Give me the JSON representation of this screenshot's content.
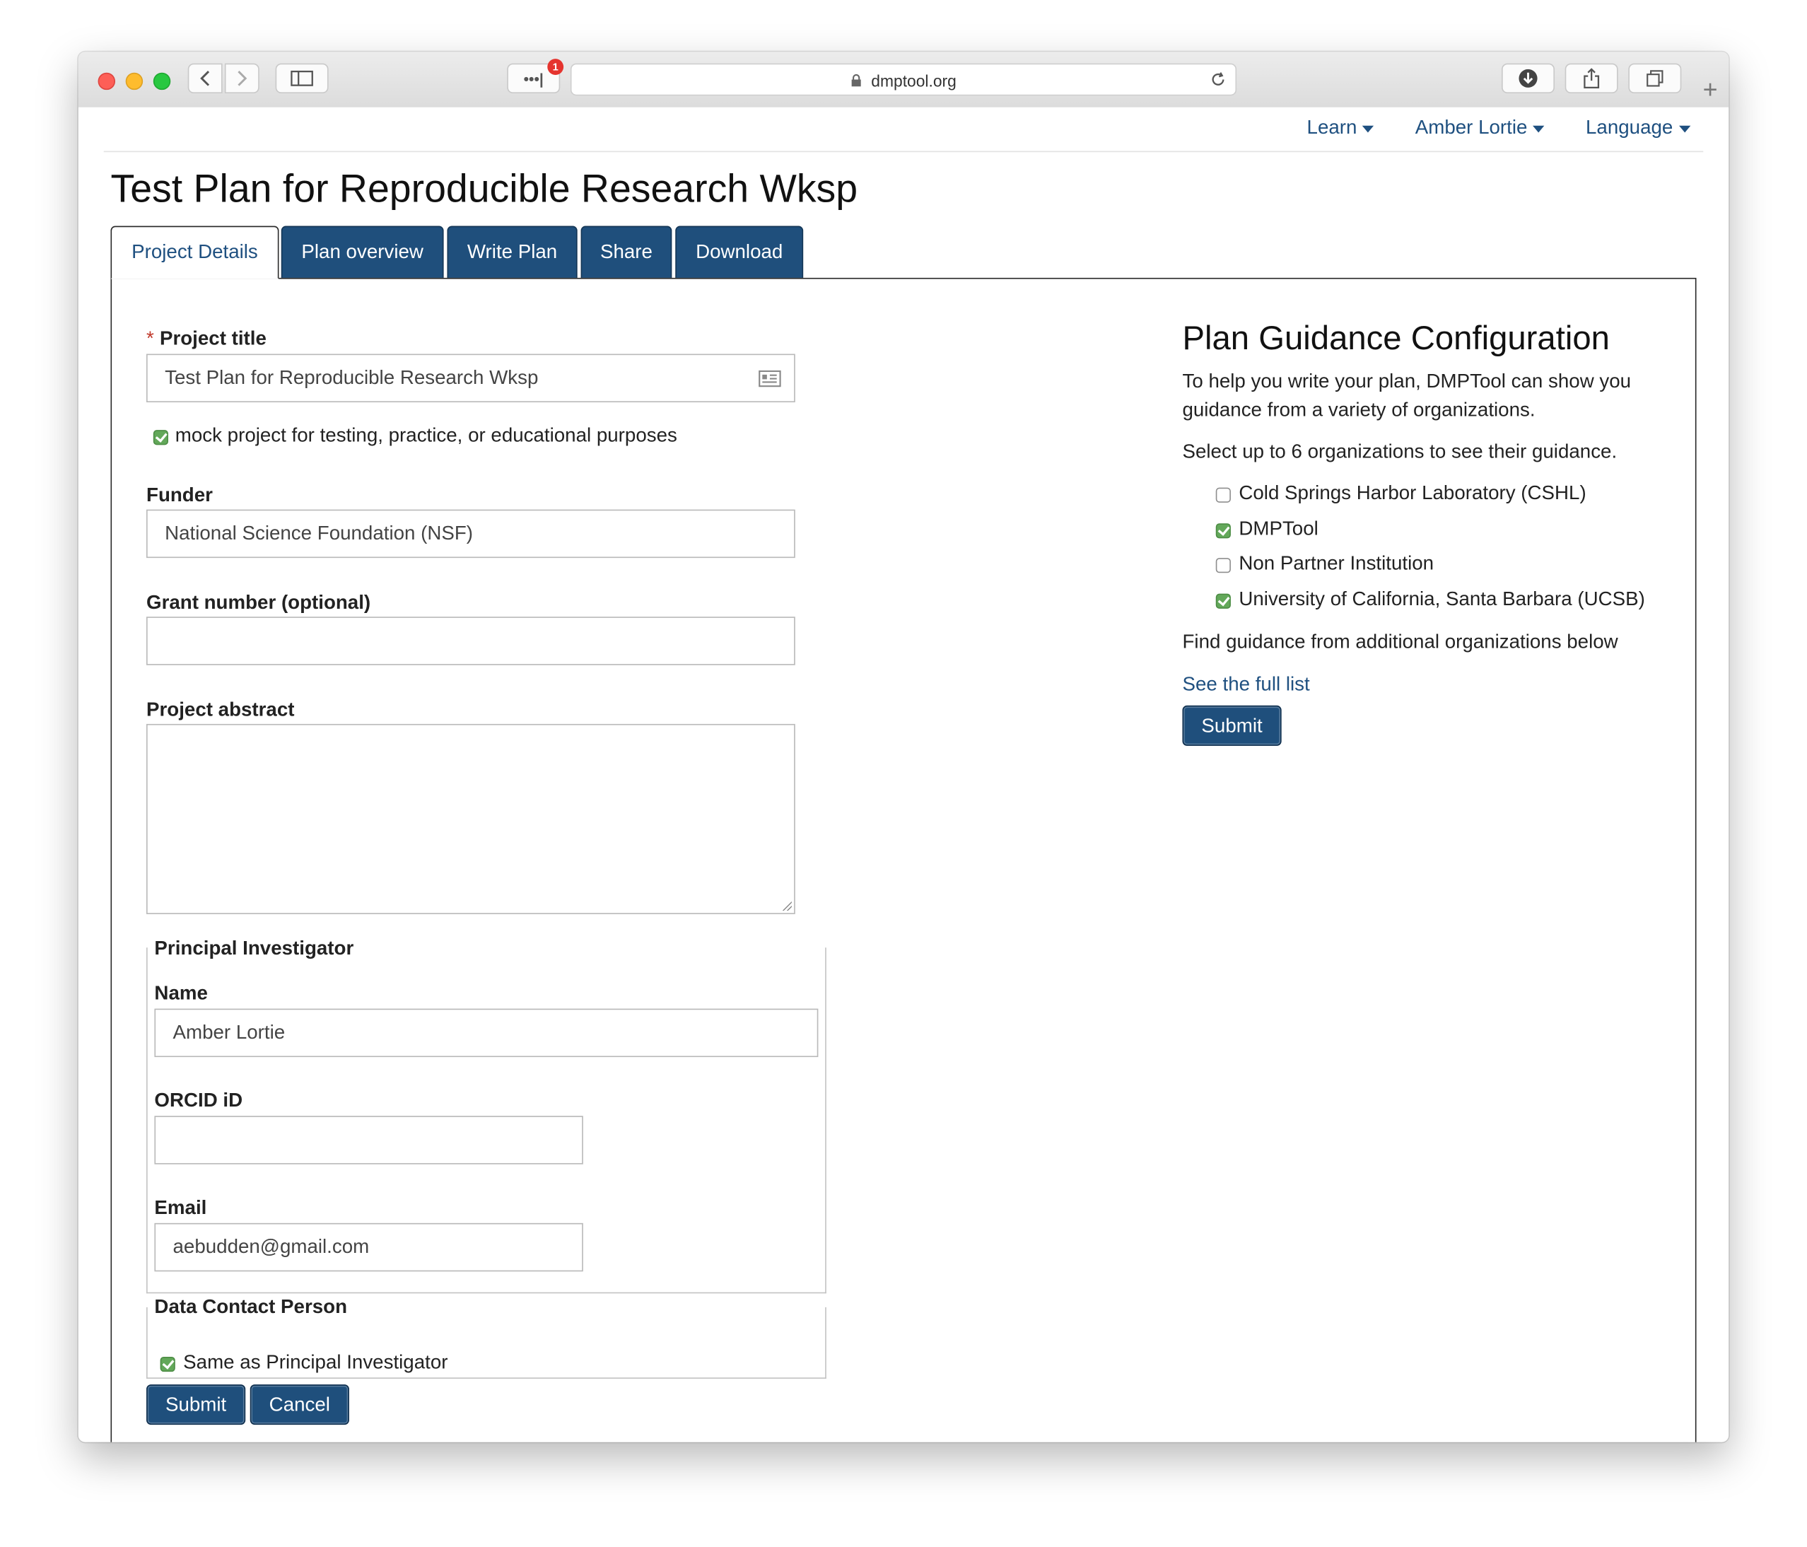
{
  "browser": {
    "url": "dmptool.org",
    "reader_badge": "1",
    "dots_label": "•••|"
  },
  "topnav": {
    "learn": "Learn",
    "user": "Amber Lortie",
    "language": "Language"
  },
  "page": {
    "title": "Test Plan for Reproducible Research Wksp"
  },
  "tabs": [
    {
      "label": "Project Details",
      "active": true
    },
    {
      "label": "Plan overview",
      "active": false
    },
    {
      "label": "Write Plan",
      "active": false
    },
    {
      "label": "Share",
      "active": false
    },
    {
      "label": "Download",
      "active": false
    }
  ],
  "form": {
    "required_marker": "*",
    "project_title_label": "Project title",
    "project_title_value": "Test Plan for Reproducible Research Wksp",
    "mock_project_label": "mock project for testing, practice, or educational purposes",
    "mock_project_checked": true,
    "funder_label": "Funder",
    "funder_value": "National Science Foundation (NSF)",
    "grant_label": "Grant number (optional)",
    "grant_value": "",
    "abstract_label": "Project abstract",
    "abstract_value": "",
    "pi_legend": "Principal Investigator",
    "name_label": "Name",
    "name_value": "Amber Lortie",
    "orcid_label": "ORCID iD",
    "orcid_value": "",
    "email_label": "Email",
    "email_value": "aebudden@gmail.com",
    "contact_legend": "Data Contact Person",
    "same_as_pi_label": "Same as Principal Investigator",
    "same_as_pi_checked": true,
    "submit_label": "Submit",
    "cancel_label": "Cancel"
  },
  "guidance": {
    "title": "Plan Guidance Configuration",
    "intro_line1": "To help you write your plan, DMPTool can show you",
    "intro_line2": "guidance from a variety of organizations.",
    "select_hint": "Select up to 6 organizations to see their guidance.",
    "organizations": [
      {
        "label": "Cold Springs Harbor Laboratory (CSHL)",
        "checked": false
      },
      {
        "label": "DMPTool",
        "checked": true
      },
      {
        "label": "Non Partner Institution",
        "checked": false
      },
      {
        "label": "University of California, Santa Barbara (UCSB)",
        "checked": true
      }
    ],
    "find_more": "Find guidance from additional organizations below",
    "full_list_link": "See the full list",
    "submit_label": "Submit"
  },
  "colors": {
    "brand_blue": "#1f4f7c",
    "link_blue": "#1f5080",
    "check_green": "#63a85a",
    "required_red": "#c0392b"
  }
}
